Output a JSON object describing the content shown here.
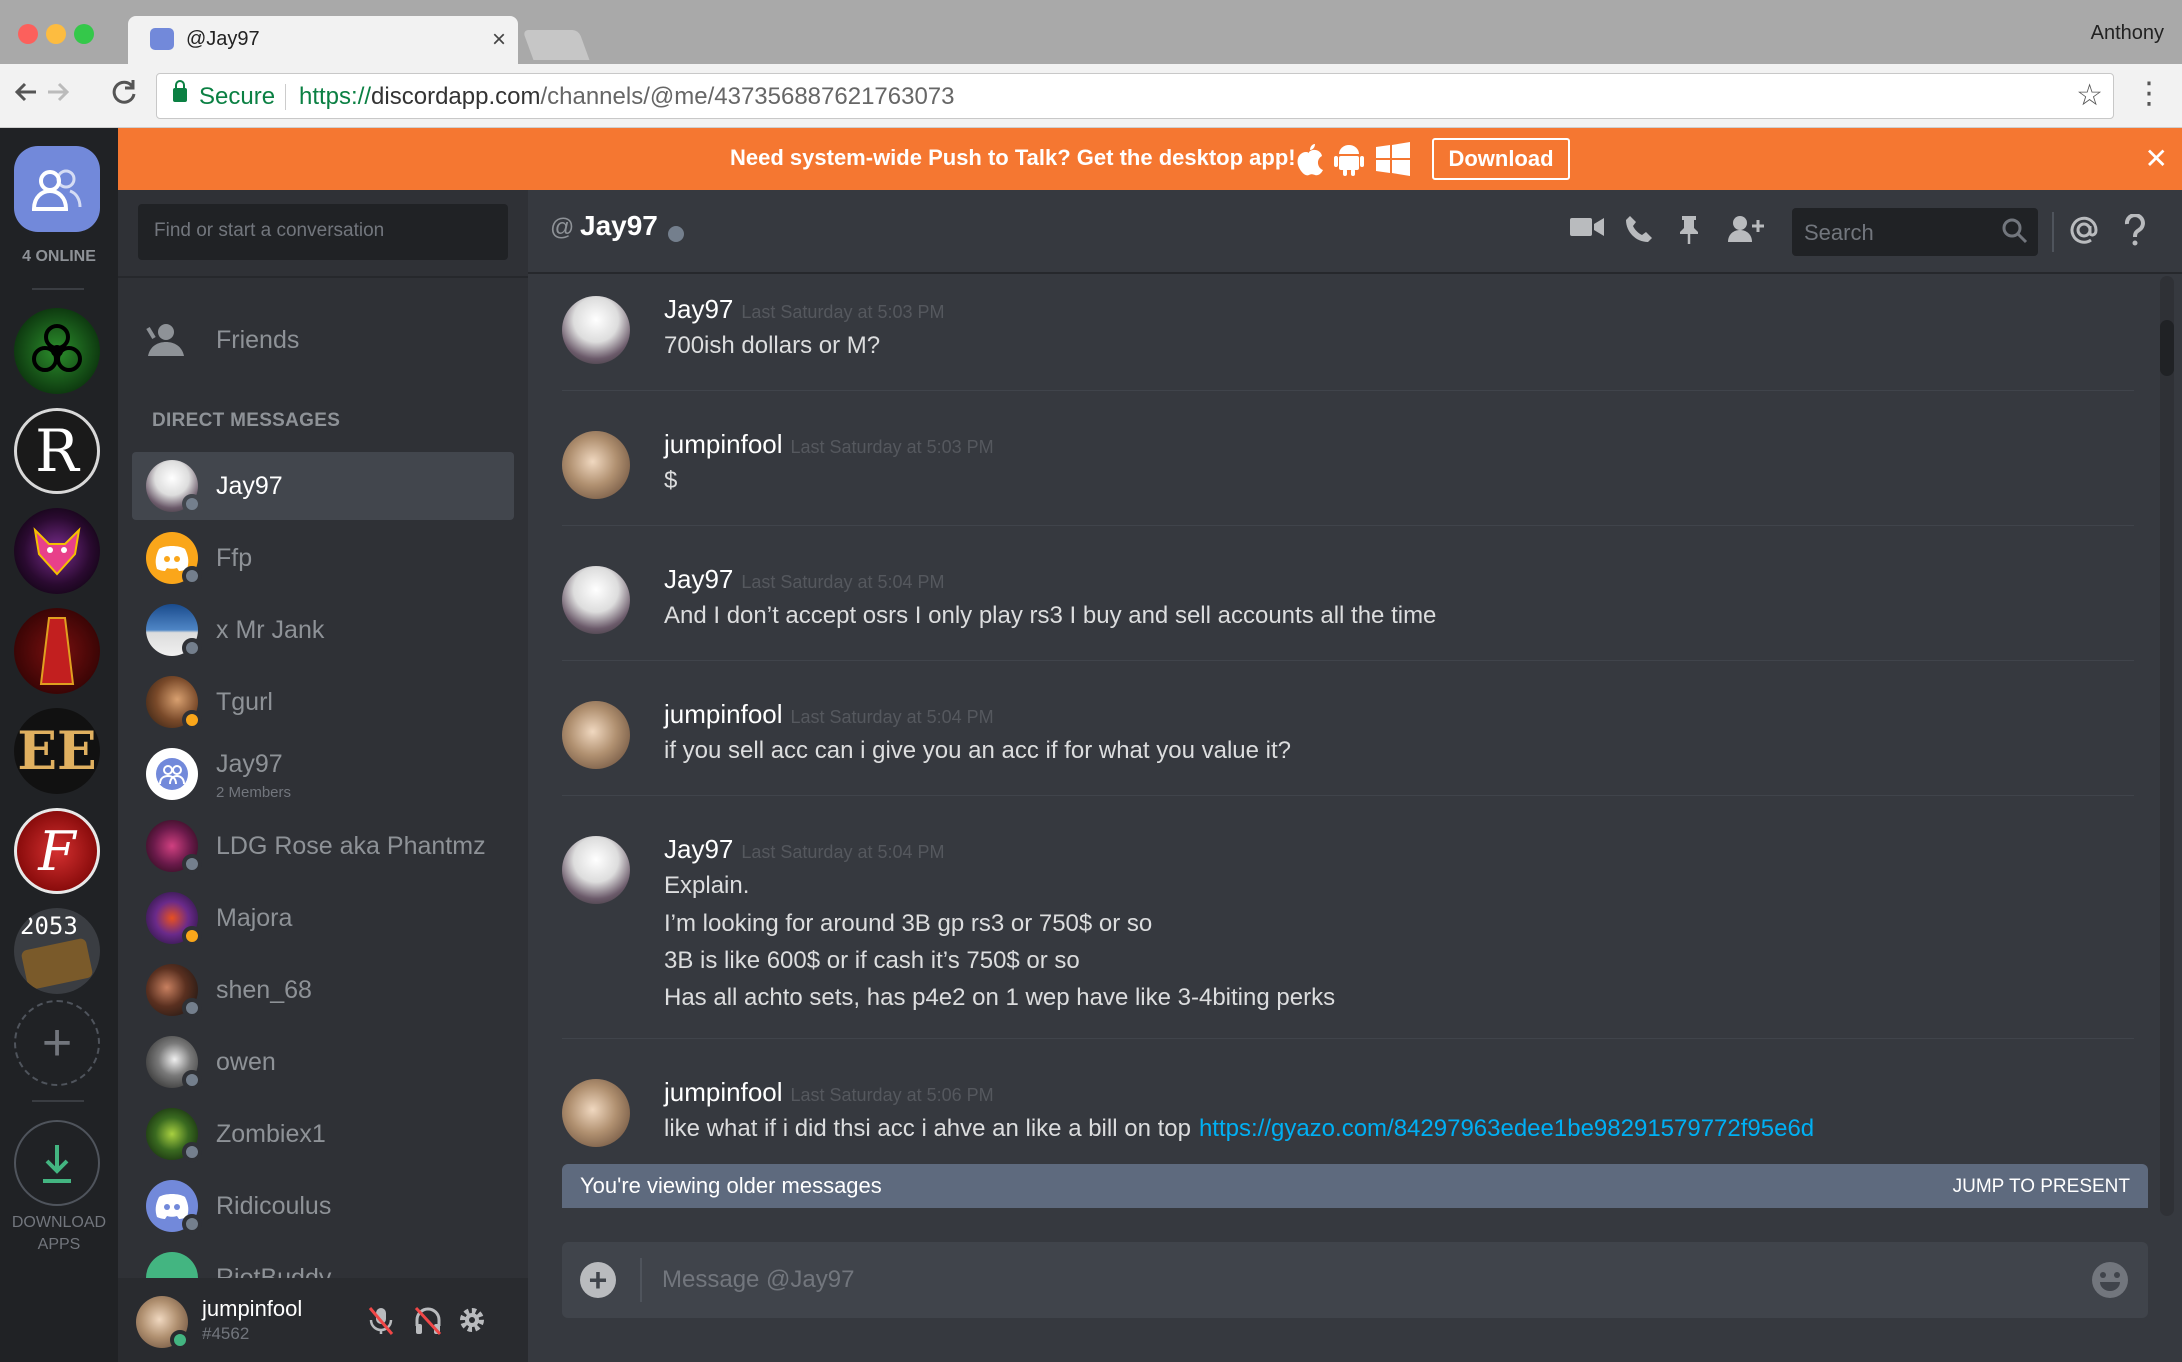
{
  "browser": {
    "tab_title": "@Jay97",
    "tab_close": "×",
    "profile_name": "Anthony",
    "secure_label": "Secure",
    "url_scheme": "https://",
    "url_host": "discordapp.com",
    "url_path": "/channels/@me/437356887621763073"
  },
  "notice": {
    "text": "Need system-wide Push to Talk? Get the desktop app!",
    "download_label": "Download",
    "os_icons": [
      "apple-icon",
      "android-icon",
      "windows-icon"
    ]
  },
  "guild_bar": {
    "online_label": "4 ONLINE",
    "guild_2053_label": "2053",
    "download_apps_label": "DOWNLOAD APPS",
    "guild_ee_label": "EE",
    "guild_r_label": "R",
    "guild_f_label": "F"
  },
  "dm_sidebar": {
    "search_placeholder": "Find or start a conversation",
    "friends_label": "Friends",
    "section_header": "DIRECT MESSAGES",
    "items": [
      {
        "name": "Jay97",
        "sub": ""
      },
      {
        "name": "Ffp",
        "sub": ""
      },
      {
        "name": "x Mr Jank",
        "sub": ""
      },
      {
        "name": "Tgurl",
        "sub": ""
      },
      {
        "name": "Jay97",
        "sub": "2 Members"
      },
      {
        "name": "LDG Rose aka Phantmz",
        "sub": ""
      },
      {
        "name": "Majora",
        "sub": ""
      },
      {
        "name": "shen_68",
        "sub": ""
      },
      {
        "name": "owen",
        "sub": ""
      },
      {
        "name": "Zombiex1",
        "sub": ""
      },
      {
        "name": "Ridicoulus",
        "sub": ""
      },
      {
        "name": "RiotBuddy",
        "sub": ""
      }
    ]
  },
  "user_panel": {
    "username": "jumpinfool",
    "discriminator": "#4562"
  },
  "chat": {
    "at_symbol": "@",
    "channel_name": "Jay97",
    "search_placeholder": "Search",
    "messages": [
      {
        "author": "Jay97",
        "time": "Last Saturday at 5:03 PM",
        "lines": [
          "700ish dollars or M?"
        ]
      },
      {
        "author": "jumpinfool",
        "time": "Last Saturday at 5:03 PM",
        "lines": [
          "$"
        ]
      },
      {
        "author": "Jay97",
        "time": "Last Saturday at 5:04 PM",
        "lines": [
          "And I don’t accept osrs I only play rs3 I buy and sell accounts all the time"
        ]
      },
      {
        "author": "jumpinfool",
        "time": "Last Saturday at 5:04 PM",
        "lines": [
          "if you sell acc can i give you an acc if for what you value it?"
        ]
      },
      {
        "author": "Jay97",
        "time": "Last Saturday at 5:04 PM",
        "lines": [
          "Explain.",
          "I’m looking for around 3B gp rs3 or 750$ or so",
          "3B is like 600$ or if cash it’s 750$ or so",
          "Has all achto sets, has p4e2 on 1 wep have like 3-4biting perks"
        ]
      },
      {
        "author": "jumpinfool",
        "time": "Last Saturday at 5:06 PM",
        "lines": [
          "like what if i did thsi acc i ahve an like a bill on top"
        ],
        "link": "https://gyazo.com/84297963edee1be98291579772f95e6d"
      }
    ],
    "older_notice": "You're viewing older messages",
    "jump_label": "JUMP TO PRESENT",
    "composer_placeholder": "Message @Jay97"
  },
  "colors": {
    "blurple": "#7289da",
    "notice_orange": "#f57731",
    "link": "#00b0f4",
    "online": "#43b581",
    "offline": "#747f8d"
  }
}
